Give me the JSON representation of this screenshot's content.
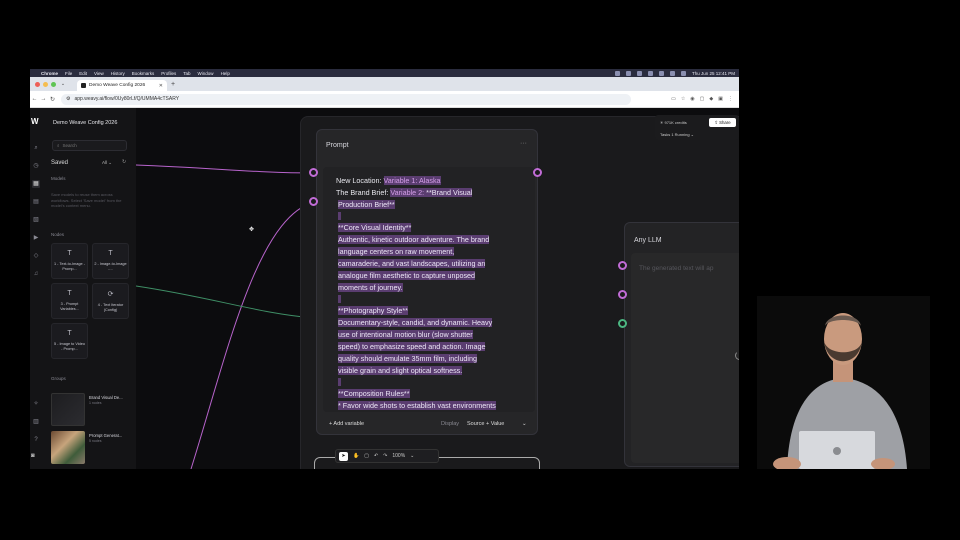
{
  "menubar": {
    "app": "Chrome",
    "items": [
      "File",
      "Edit",
      "View",
      "History",
      "Bookmarks",
      "Profiles",
      "Tab",
      "Window",
      "Help"
    ],
    "clock": "Thu Jun 25  12:41 PM"
  },
  "browser": {
    "tab_title": "Demo Weave Config 2026",
    "url": "app.weavy.ai/flow/0Uy80rLf/Q/UMMA4cTSARY",
    "new_tab": "+"
  },
  "sidebar": {
    "project_title": "Demo Weave Config 2026",
    "search_placeholder": "Search",
    "saved_label": "Saved",
    "filter_value": "All",
    "models_label": "Models",
    "models_note": "Save models to reuse them across workflows. Select 'Save model' from the model's context menu.",
    "nodes_label": "Nodes",
    "nodes": [
      {
        "icon": "T",
        "label": "1 - Text-to-Image - Promp..."
      },
      {
        "icon": "T",
        "label": "2 - Image-to-Image -..."
      },
      {
        "icon": "T",
        "label": "3 - Prompt Variables..."
      },
      {
        "icon": "⟳",
        "label": "4 - Text Iterator (Config)"
      },
      {
        "icon": "T",
        "label": "5 - Image to Video - Promp..."
      }
    ],
    "groups_label": "Groups",
    "groups": [
      {
        "title": "Brand Visual De...",
        "sub": "1 nodes"
      },
      {
        "title": "Prompt Generat...",
        "sub": "5 nodes"
      }
    ]
  },
  "topright": {
    "credits": "✳ 971K credits",
    "tasks": "Tasks  1 Running  ⌄",
    "share": "⇪ Share"
  },
  "prompt_node": {
    "title": "Prompt",
    "menu": "···",
    "line1_prefix": "New Location: ",
    "line1_var": "Variable 1: Alaska",
    "line2_prefix": "The Brand Brief: ",
    "line2_var": "Variable 2:",
    "line2_rest": " **Brand Visual",
    "line3": "Production Brief**",
    "line4": "**Core Visual Identity**",
    "line5": "Authentic, kinetic outdoor adventure. The brand",
    "line6": "language centers on raw movement,",
    "line7": "camaraderie, and vast landscapes, utilizing an",
    "line8": "analogue film aesthetic to capture unposed",
    "line9": "moments of journey.",
    "line10": "**Photography Style**",
    "line11": "Documentary-style, candid, and dynamic. Heavy",
    "line12": "use of intentional motion blur (slow shutter",
    "line13": "speed) to emphasize speed and action. Image",
    "line14": "quality should emulate 35mm film, including",
    "line15": "visible grain and slight optical softness.",
    "line16": "**Composition Rules**",
    "line17": "* Favor wide shots to establish vast environments",
    "add_variable": "+ Add variable",
    "display_label": "Display",
    "display_value": "Source + Value",
    "display_chevron": "⌄"
  },
  "llm_node": {
    "title": "Any LLM",
    "placeholder": "The generated text will ap"
  },
  "toolbar": {
    "zoom": "100%"
  },
  "colors": {
    "accent_port": "#c16cd6",
    "green_port": "#4cb782",
    "highlight": "#5a3d70"
  }
}
